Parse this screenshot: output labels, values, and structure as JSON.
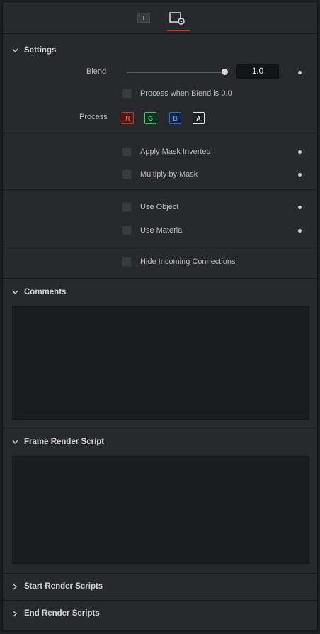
{
  "tabs": [
    {
      "icon": "tools-tab-icon"
    },
    {
      "icon": "settings-tab-icon",
      "active": true
    }
  ],
  "colors": {
    "accent": "#c0392b",
    "red": "#c0392b",
    "green": "#27ae60",
    "blue": "#2e6fd1"
  },
  "settings": {
    "title": "Settings",
    "blend_label": "Blend",
    "blend_value": "1.0",
    "process_when_blend_zero": "Process when Blend is 0.0",
    "process_label": "Process",
    "channels": [
      "R",
      "G",
      "B",
      "A"
    ],
    "apply_mask_inverted": "Apply Mask Inverted",
    "multiply_by_mask": "Multiply by Mask",
    "use_object": "Use Object",
    "use_material": "Use Material",
    "hide_incoming": "Hide Incoming Connections"
  },
  "comments": {
    "title": "Comments"
  },
  "frame_render_script": {
    "title": "Frame Render Script"
  },
  "start_render_scripts": {
    "title": "Start Render Scripts"
  },
  "end_render_scripts": {
    "title": "End Render Scripts"
  }
}
